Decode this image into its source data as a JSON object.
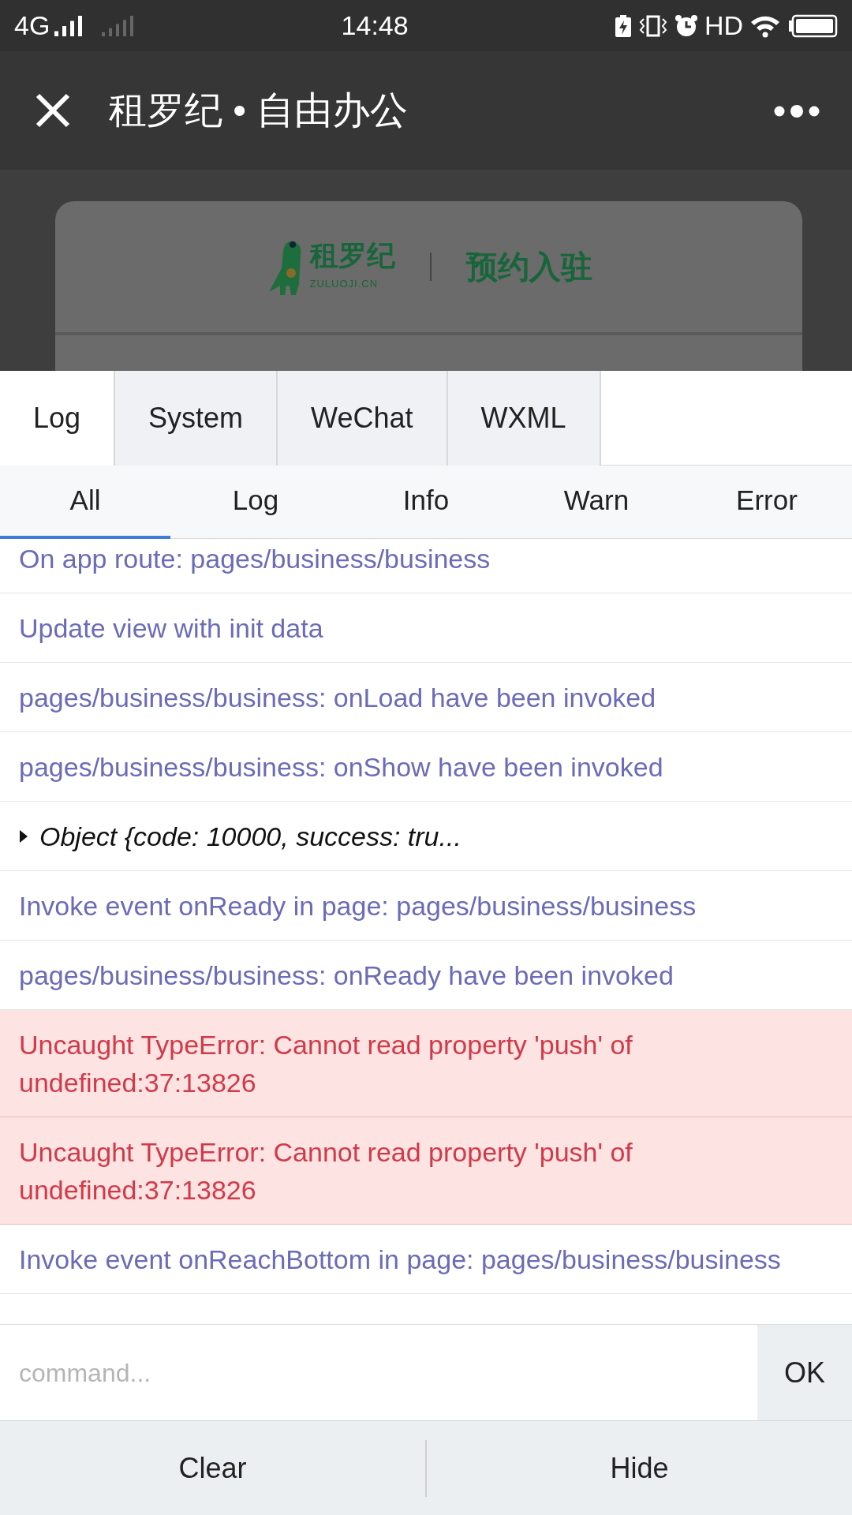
{
  "status_bar": {
    "network": "4G",
    "time": "14:48",
    "hd": "HD"
  },
  "nav": {
    "title": "租罗纪 • 自由办公"
  },
  "card": {
    "brand": "租罗纪",
    "domain": "ZULUOJI.CN",
    "heading": "预约入驻"
  },
  "tabs": [
    {
      "label": "Log",
      "selected": true
    },
    {
      "label": "System",
      "selected": false
    },
    {
      "label": "WeChat",
      "selected": false
    },
    {
      "label": "WXML",
      "selected": false
    }
  ],
  "filters": [
    {
      "label": "All",
      "selected": true
    },
    {
      "label": "Log",
      "selected": false
    },
    {
      "label": "Info",
      "selected": false
    },
    {
      "label": "Warn",
      "selected": false
    },
    {
      "label": "Error",
      "selected": false
    }
  ],
  "logs": [
    {
      "kind": "log",
      "text": "On app route: pages/business/business"
    },
    {
      "kind": "log",
      "text": "Update view with init data"
    },
    {
      "kind": "log",
      "text": "pages/business/business: onLoad have been invoked"
    },
    {
      "kind": "log",
      "text": "pages/business/business: onShow have been invoked"
    },
    {
      "kind": "object",
      "text": "Object {code: 10000, success: tru..."
    },
    {
      "kind": "log",
      "text": "Invoke event onReady in page: pages/business/business"
    },
    {
      "kind": "log",
      "text": "pages/business/business: onReady have been invoked"
    },
    {
      "kind": "error",
      "text": "Uncaught TypeError: Cannot read property 'push' of undefined:37:13826"
    },
    {
      "kind": "error",
      "text": "Uncaught TypeError: Cannot read property 'push' of undefined:37:13826"
    },
    {
      "kind": "log",
      "text": "Invoke event onReachBottom in page: pages/business/business"
    }
  ],
  "command": {
    "placeholder": "command...",
    "button": "OK"
  },
  "footer": [
    "Clear",
    "Hide"
  ]
}
